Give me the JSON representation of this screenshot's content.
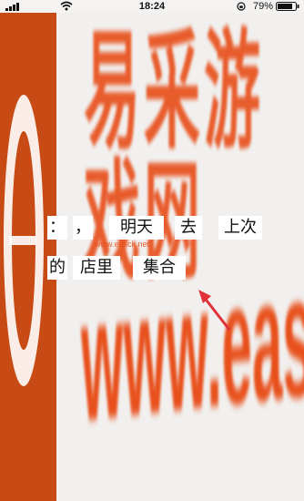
{
  "status_bar": {
    "time": "18:24",
    "battery_percent": "79%",
    "signal_icon": "signal-icon",
    "wifi_icon": "wifi-icon",
    "lock_icon": "rotation-lock-icon",
    "battery_icon": "battery-icon"
  },
  "captcha": {
    "row1": [
      {
        "id": "t1",
        "text": "："
      },
      {
        "id": "t2",
        "text": "，"
      },
      {
        "id": "t3",
        "text": "明天"
      },
      {
        "id": "t4",
        "text": "去"
      },
      {
        "id": "t5",
        "text": "上次"
      }
    ],
    "row2": [
      {
        "id": "t6",
        "text": "的"
      },
      {
        "id": "t7",
        "text": "店里"
      },
      {
        "id": "t8",
        "text": "集合"
      }
    ]
  },
  "watermark": {
    "title": "易采游戏网",
    "url": "www.easck.net",
    "small_url": "www.easck.net"
  },
  "colors": {
    "accent": "#e8501c",
    "banner": "#c84a14",
    "background": "#f1f0ee"
  }
}
